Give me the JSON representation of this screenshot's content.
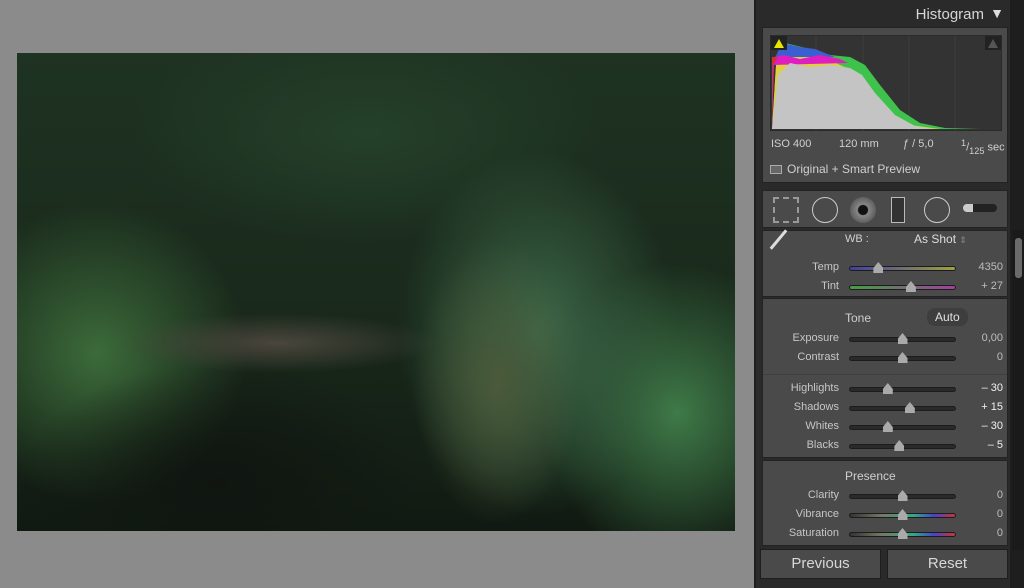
{
  "histogram": {
    "title": "Histogram",
    "iso": "ISO 400",
    "focal": "120 mm",
    "aperture": "ƒ / 5,0",
    "shutter_num": "1",
    "shutter_den": "125",
    "shutter_unit": "sec",
    "preview": "Original + Smart Preview"
  },
  "tools": [
    "crop-overlay",
    "spot-removal",
    "red-eye",
    "graduated-filter",
    "radial-filter",
    "adjustment-brush"
  ],
  "wb": {
    "label": "WB :",
    "value": "As Shot"
  },
  "sliders": {
    "temp": {
      "label": "Temp",
      "value": "4350",
      "pos": 0.27
    },
    "tint": {
      "label": "Tint",
      "value": "+ 27",
      "pos": 0.58
    },
    "exposure": {
      "label": "Exposure",
      "value": "0,00",
      "pos": 0.5
    },
    "contrast": {
      "label": "Contrast",
      "value": "0",
      "pos": 0.5
    },
    "highlights": {
      "label": "Highlights",
      "value": "– 30",
      "pos": 0.36
    },
    "shadows": {
      "label": "Shadows",
      "value": "+ 15",
      "pos": 0.57
    },
    "whites": {
      "label": "Whites",
      "value": "– 30",
      "pos": 0.36
    },
    "blacks": {
      "label": "Blacks",
      "value": "– 5",
      "pos": 0.47
    },
    "clarity": {
      "label": "Clarity",
      "value": "0",
      "pos": 0.5
    },
    "vibrance": {
      "label": "Vibrance",
      "value": "0",
      "pos": 0.5
    },
    "saturation": {
      "label": "Saturation",
      "value": "0",
      "pos": 0.5
    }
  },
  "tone": {
    "title": "Tone",
    "auto": "Auto"
  },
  "presence": {
    "title": "Presence"
  },
  "buttons": {
    "previous": "Previous",
    "reset": "Reset"
  },
  "colors": {
    "panel": "#4a4a4a",
    "canvas": "#8b8b8b",
    "clip_warning": "#e6e600"
  }
}
